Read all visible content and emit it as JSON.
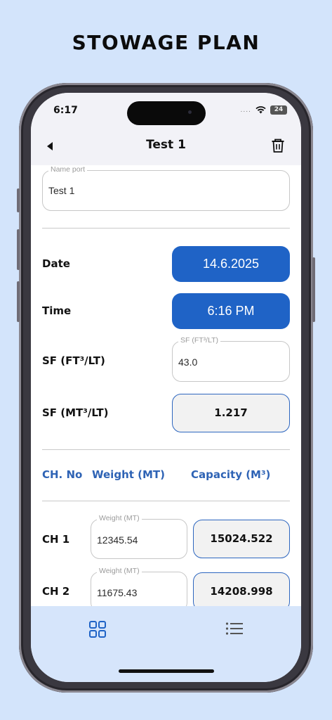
{
  "promo": {
    "title": "STOWAGE PLAN"
  },
  "status_bar": {
    "time": "6:17",
    "signal": "....",
    "battery": "24"
  },
  "nav": {
    "title": "Test 1"
  },
  "name_port": {
    "label": "Name port",
    "value": "Test 1"
  },
  "date": {
    "label": "Date",
    "value": "14.6.2025"
  },
  "time": {
    "label": "Time",
    "value": "6:16 PM"
  },
  "sf_ft": {
    "label": "SF (FT³/LT)",
    "field_label": "SF (FT³/LT)",
    "value": "43.0"
  },
  "sf_mt": {
    "label": "SF (MT³/LT)",
    "value": "1.217"
  },
  "table": {
    "headers": [
      "CH. No",
      "Weight (MT)",
      "Capacity (M³)"
    ],
    "rows": [
      {
        "ch": "CH 1",
        "weight_label": "Weight (MT)",
        "weight": "12345.54",
        "capacity": "15024.522"
      },
      {
        "ch": "CH 2",
        "weight_label": "Weight (MT)",
        "weight": "11675.43",
        "capacity": "14208.998"
      }
    ]
  },
  "tabs": [
    {
      "icon": "grid-icon",
      "active": true
    },
    {
      "icon": "list-icon",
      "active": false
    }
  ],
  "colors": {
    "accent": "#1f63c6",
    "header_text": "#2e63b5",
    "background": "#d3e4fb",
    "tabbar": "#d6e5fb"
  }
}
